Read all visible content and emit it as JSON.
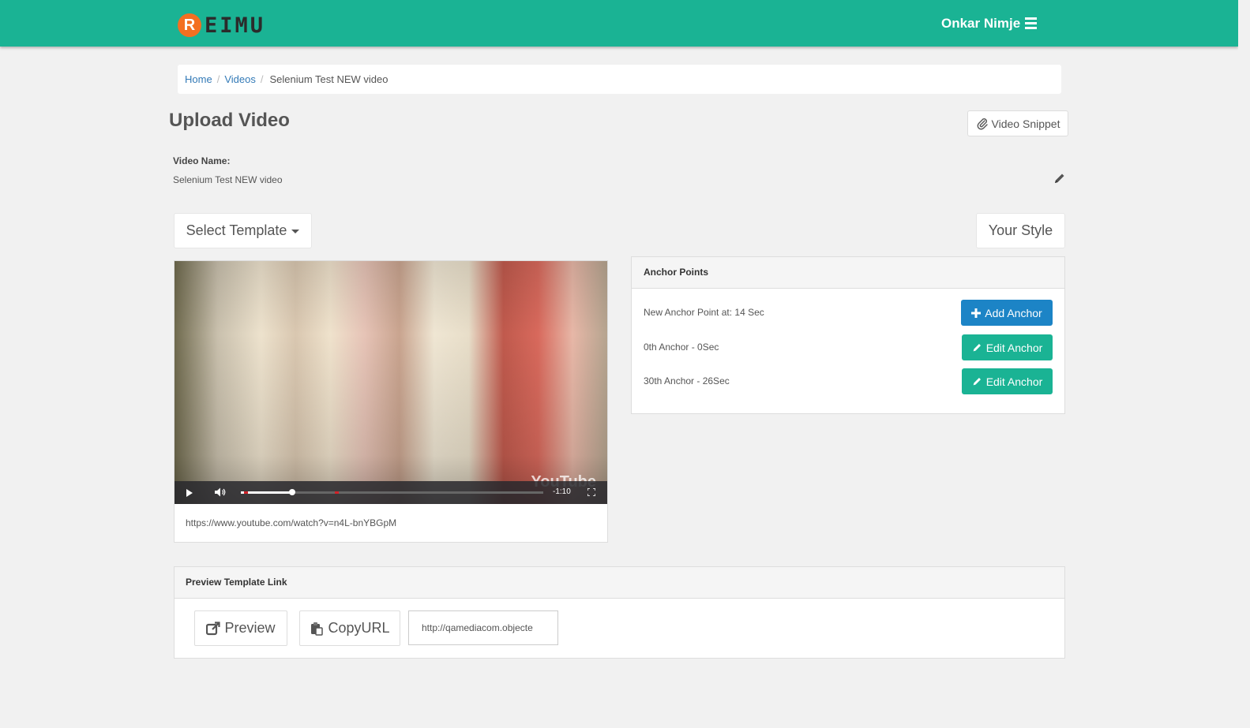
{
  "header": {
    "logo_letter": "R",
    "logo_text": "EIMU",
    "user_name": "Onkar Nimje"
  },
  "breadcrumb": {
    "home": "Home",
    "videos": "Videos",
    "current": "Selenium Test NEW video"
  },
  "page": {
    "title": "Upload Video",
    "snippet_button": "Video Snippet",
    "video_name_label": "Video Name:",
    "video_name_value": "Selenium Test NEW video"
  },
  "toolbar": {
    "select_template": "Select Template",
    "your_style": "Your Style"
  },
  "video": {
    "watermark": "YouTube",
    "time_remaining": "-1:10",
    "progress_fraction": 0.17,
    "marker_positions": [
      0.01,
      0.31
    ],
    "url": "https://www.youtube.com/watch?v=n4L-bnYBGpM"
  },
  "anchors": {
    "heading": "Anchor Points",
    "new_anchor_text": "New Anchor Point at: 14 Sec",
    "add_button": "Add Anchor",
    "items": [
      {
        "label": "0th Anchor - 0Sec",
        "button": "Edit Anchor"
      },
      {
        "label": "30th Anchor - 26Sec",
        "button": "Edit Anchor"
      }
    ]
  },
  "preview": {
    "heading": "Preview Template Link",
    "preview_button": "Preview",
    "copy_button": "CopyURL",
    "link_value": "http://qamediacom.objecte"
  },
  "colors": {
    "topbar": "#1ab394",
    "primary": "#1c84c6",
    "success": "#1ab394",
    "logo_accent": "#f36f21"
  }
}
